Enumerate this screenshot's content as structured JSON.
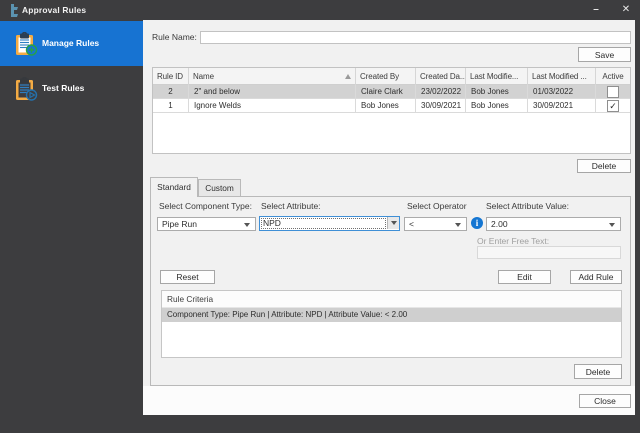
{
  "window": {
    "title": "Approval Rules",
    "minimize_glyph": "–",
    "close_glyph": "✕"
  },
  "sidebar": {
    "items": [
      {
        "label": "Manage Rules",
        "icon": "clipboard-add-icon",
        "active": true
      },
      {
        "label": "Test Rules",
        "icon": "clipboard-play-icon",
        "active": false
      }
    ]
  },
  "form": {
    "rule_name_label": "Rule Name:",
    "rule_name_value": "",
    "save_label": "Save",
    "grid": {
      "columns": [
        "Rule ID",
        "Name",
        "Created By",
        "Created Da...",
        "Last Modifie...",
        "Last Modified ...",
        "Active"
      ],
      "sort_column": "Name",
      "rows": [
        {
          "rule_id": "2",
          "name": "2\" and below",
          "created_by": "Claire Clark",
          "created_date": "23/02/2022",
          "last_modified_by": "Bob Jones",
          "last_modified_date": "01/03/2022",
          "active": false,
          "active_glyph": "",
          "selected": true
        },
        {
          "rule_id": "1",
          "name": "Ignore Welds",
          "created_by": "Bob Jones",
          "created_date": "30/09/2021",
          "last_modified_by": "Bob Jones",
          "last_modified_date": "30/09/2021",
          "active": true,
          "active_glyph": "✓",
          "selected": false
        }
      ]
    },
    "delete_label": "Delete",
    "tabs": [
      {
        "label": "Standard",
        "active": true
      },
      {
        "label": "Custom",
        "active": false
      }
    ],
    "standard_tab": {
      "component_type_label": "Select Component Type:",
      "component_type_value": "Pipe Run",
      "attribute_label": "Select Attribute:",
      "attribute_value": "NPD",
      "operator_label": "Select Operator",
      "operator_value": "<",
      "attribute_value_label": "Select Attribute Value:",
      "attribute_value_value": "2.00",
      "info_icon_glyph": "i",
      "free_text_label": "Or Enter Free Text:",
      "free_text_value": "",
      "reset_label": "Reset",
      "edit_label": "Edit",
      "add_rule_label": "Add Rule",
      "criteria_header": "Rule Criteria",
      "criteria_items": [
        "Component Type: Pipe Run | Attribute: NPD | Attribute Value: < 2.00"
      ],
      "criteria_delete_label": "Delete"
    },
    "close_label": "Close"
  },
  "colors": {
    "chrome": "#3d3d3f",
    "accent_blue": "#1773d2",
    "main_background": "#f1f1f1",
    "selected_row": "#d2d2d2",
    "info_blue": "#1576d2"
  }
}
